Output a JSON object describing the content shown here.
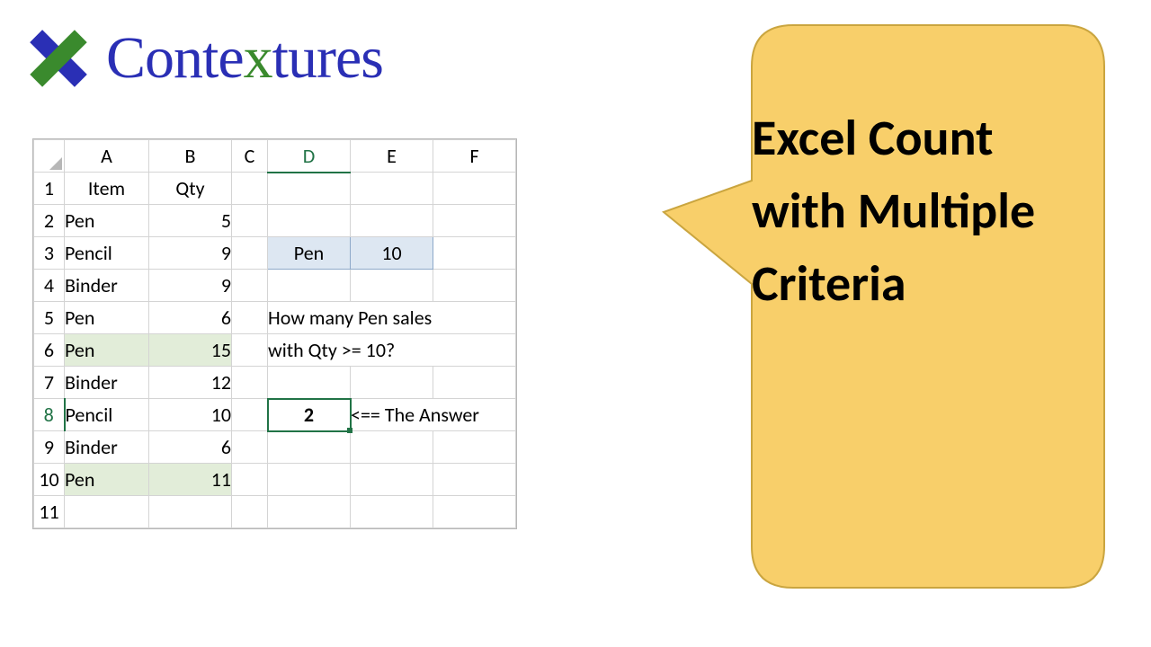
{
  "logo": {
    "text_pre": "Conte",
    "text_x": "x",
    "text_post": "tures"
  },
  "columns": [
    "A",
    "B",
    "C",
    "D",
    "E",
    "F"
  ],
  "rows": [
    "1",
    "2",
    "3",
    "4",
    "5",
    "6",
    "7",
    "8",
    "9",
    "10",
    "11"
  ],
  "headers": {
    "item": "Item",
    "qty": "Qty"
  },
  "data": [
    {
      "item": "Pen",
      "qty": "5",
      "hl": false
    },
    {
      "item": "Pencil",
      "qty": "9",
      "hl": false
    },
    {
      "item": "Binder",
      "qty": "9",
      "hl": false
    },
    {
      "item": "Pen",
      "qty": "6",
      "hl": false
    },
    {
      "item": "Pen",
      "qty": "15",
      "hl": true
    },
    {
      "item": "Binder",
      "qty": "12",
      "hl": false
    },
    {
      "item": "Pencil",
      "qty": "10",
      "hl": false
    },
    {
      "item": "Binder",
      "qty": "6",
      "hl": false
    },
    {
      "item": "Pen",
      "qty": "11",
      "hl": true
    }
  ],
  "criteria": {
    "item": "Pen",
    "qty": "10"
  },
  "question": {
    "line1": "How many Pen sales",
    "line2": "with Qty >= 10?"
  },
  "answer": {
    "value": "2",
    "label": "<== The Answer"
  },
  "callout": {
    "text": "Excel Count with Multiple Criteria"
  },
  "colors": {
    "accent": "#217346",
    "callout": "#f8cf6a",
    "header_blue": "#1a3fd6"
  }
}
